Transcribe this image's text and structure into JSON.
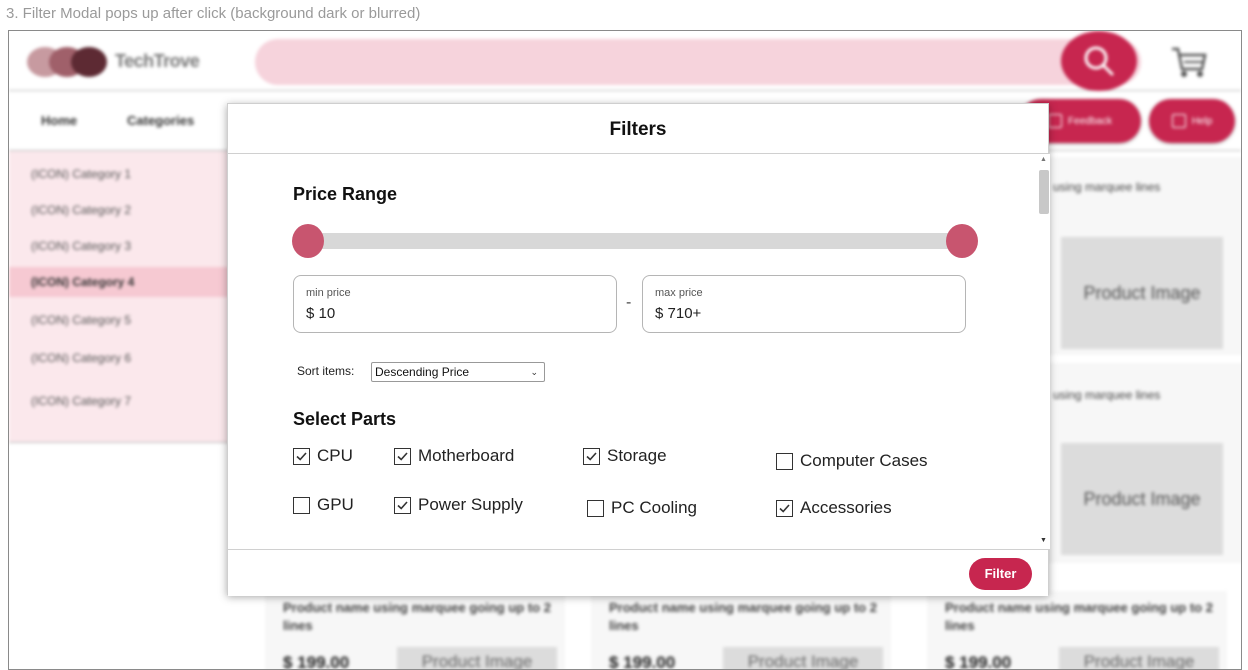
{
  "caption": "3. Filter Modal pops up after click (background dark or blurred)",
  "header": {
    "logo_text": "TechTrove",
    "search_icon": "search-icon",
    "cart_icon": "cart-icon"
  },
  "nav": {
    "home": "Home",
    "categories": "Categories",
    "feedback": "Feedback",
    "help": "Help"
  },
  "sidebar": {
    "items": [
      {
        "label": "(ICON) Category 1"
      },
      {
        "label": "(ICON) Category 2"
      },
      {
        "label": "(ICON) Category 3"
      },
      {
        "label": "(ICON) Category 4",
        "active": true
      },
      {
        "label": "(ICON) Category 5"
      },
      {
        "label": "(ICON) Category 6"
      },
      {
        "label": "(ICON) Category 7"
      }
    ]
  },
  "products": {
    "side_text_1": "using marquee lines",
    "side_text_2": "using marquee lines",
    "image_label": "Product Image",
    "bottom": [
      {
        "name": "Product name using marquee going up to 2 lines",
        "price": "$ 199.00",
        "image": "Product Image"
      },
      {
        "name": "Product name using marquee going up to 2 lines",
        "price": "$ 199.00",
        "image": "Product Image"
      },
      {
        "name": "Product name using marquee going up to 2 lines",
        "price": "$ 199.00",
        "image": "Product Image"
      }
    ]
  },
  "modal": {
    "title": "Filters",
    "price_range_title": "Price Range",
    "slider_min_fraction": 0.0,
    "slider_max_fraction": 1.0,
    "min_price_label": "min price",
    "min_price_value": "$ 10",
    "max_price_label": "max price",
    "max_price_value": "$ 710+",
    "separator": "-",
    "sort_label": "Sort items:",
    "sort_value": "Descending Price",
    "parts_title": "Select Parts",
    "parts": [
      {
        "label": "CPU",
        "checked": true
      },
      {
        "label": "Motherboard",
        "checked": true
      },
      {
        "label": "Storage",
        "checked": true
      },
      {
        "label": "Computer Cases",
        "checked": false
      },
      {
        "label": "GPU",
        "checked": false
      },
      {
        "label": "Power Supply",
        "checked": true
      },
      {
        "label": "PC Cooling",
        "checked": false
      },
      {
        "label": "Accessories",
        "checked": true
      }
    ],
    "filter_button": "Filter"
  },
  "colors": {
    "accent": "#c7264f",
    "slider_thumb": "#c8556f",
    "search_bar": "#f6d3dc",
    "sidebar_bg": "#fbe8ec",
    "sidebar_active": "#f6c9d2"
  }
}
